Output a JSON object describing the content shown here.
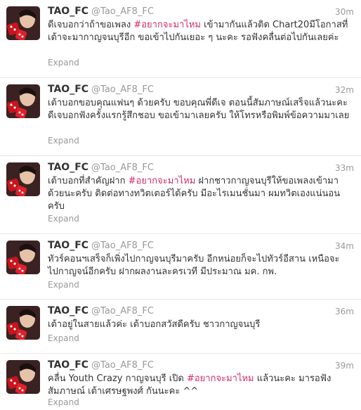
{
  "tweets": [
    {
      "fullname": "TAO_FC",
      "username": "@Tao_AF8_FC",
      "time": "30m",
      "text_before": "ดีเจบอกว่าถ้าขอเพลง ",
      "hashtag": "#อยากจะมาไหม",
      "text_after": " เข้ามากันแล้วติด Chart20มีโอกาสที่เต้าจะมากาญจนบุรีอีก ขอเข้าไปกันเยอะ ๆ นะคะ รอฟังคลื่นต่อไปกันเลยค่ะ",
      "expand": "Expand"
    },
    {
      "fullname": "TAO_FC",
      "username": "@Tao_AF8_FC",
      "time": "32m",
      "text_before": "เต้าบอกขอบคุณแฟนๆ ด้วยครับ ขอบคุณพี่ดีเจ ตอนนี้สัมภาษณ์เสร็จแล้วนะคะ ดีเจบอกฟังครั้งแรกรู้สึกชอบ ขอเข้ามาเลยครับ ให้โทรหรือพิมพ์ข้อความมาเลย",
      "hashtag": "",
      "text_after": "",
      "expand": "Expand"
    },
    {
      "fullname": "TAO_FC",
      "username": "@Tao_AF8_FC",
      "time": "33m",
      "text_before": "เต้าบอกที่สำคัญฝาก ",
      "hashtag": "#อยากจะมาไหม",
      "text_after": " ฝากชาวกาญจนบุรีให้ขอเพลงเข้ามาด้วยนะครับ ติดต่อทางทวิตเตอร์ได้ครับ มีอะไรเมนชั่นมา ผมทวิตเองแน่นอนครับ",
      "expand": "Expand"
    },
    {
      "fullname": "TAO_FC",
      "username": "@Tao_AF8_FC",
      "time": "34m",
      "text_before": "ทัวร์คอนฯเสร็จก็เพิ่งไปกาญจนบุรีมาครับ อีกหน่อยก็จะไปทัวร์อีสาน เหนือจะไปกาญจน์อีกครับ ฝากผลงานละครเวที มีประมาณ มค. กพ.",
      "hashtag": "",
      "text_after": "",
      "expand": "Expand"
    },
    {
      "fullname": "TAO_FC",
      "username": "@Tao_AF8_FC",
      "time": "36m",
      "text_before": "เต้าอยู่ในสายแล้วค่ะ เต้าบอกสวัสดีครับ ชาวกาญจนบุรี",
      "hashtag": "",
      "text_after": "",
      "expand": "Expand"
    },
    {
      "fullname": "TAO_FC",
      "username": "@Tao_AF8_FC",
      "time": "39m",
      "text_before": "คลื่น Youth Crazy กาญจนบุรี เปิด ",
      "hashtag": "#อยากจะมาไหม",
      "text_after": " แล้วนะคะ มารอฟังสัมภาษณ์ เต้าเศรษฐพงศ์ กันนะคะ ^^",
      "expand": "Expand"
    }
  ],
  "colors": {
    "hashtag": "#d22e62",
    "muted": "#999999",
    "text": "#333333"
  },
  "icons": {
    "avatar": "profile-photo-with-red-dice"
  }
}
